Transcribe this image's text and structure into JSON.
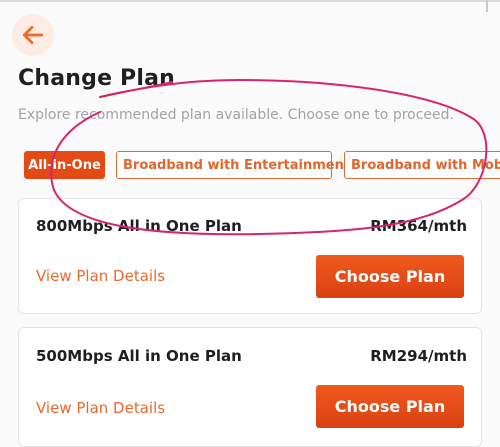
{
  "header": {
    "title": "Change Plan",
    "subtitle": "Explore recommended plan available. Choose one to proceed."
  },
  "tabs": [
    {
      "label": "All-in-One",
      "active": true
    },
    {
      "label": "Broadband with Entertainment",
      "active": false
    },
    {
      "label": "Broadband with Mobile",
      "active": false
    }
  ],
  "plans": [
    {
      "name": "800Mbps All in One Plan",
      "price": "RM364/mth",
      "details_link": "View Plan Details",
      "cta": "Choose Plan"
    },
    {
      "name": "500Mbps All in One Plan",
      "price": "RM294/mth",
      "details_link": "View Plan Details",
      "cta": "Choose Plan"
    }
  ],
  "colors": {
    "accent": "#e44a16",
    "link": "#e8692e",
    "annotation": "#d6246e"
  },
  "icons": {
    "back": "arrow-left-icon"
  }
}
